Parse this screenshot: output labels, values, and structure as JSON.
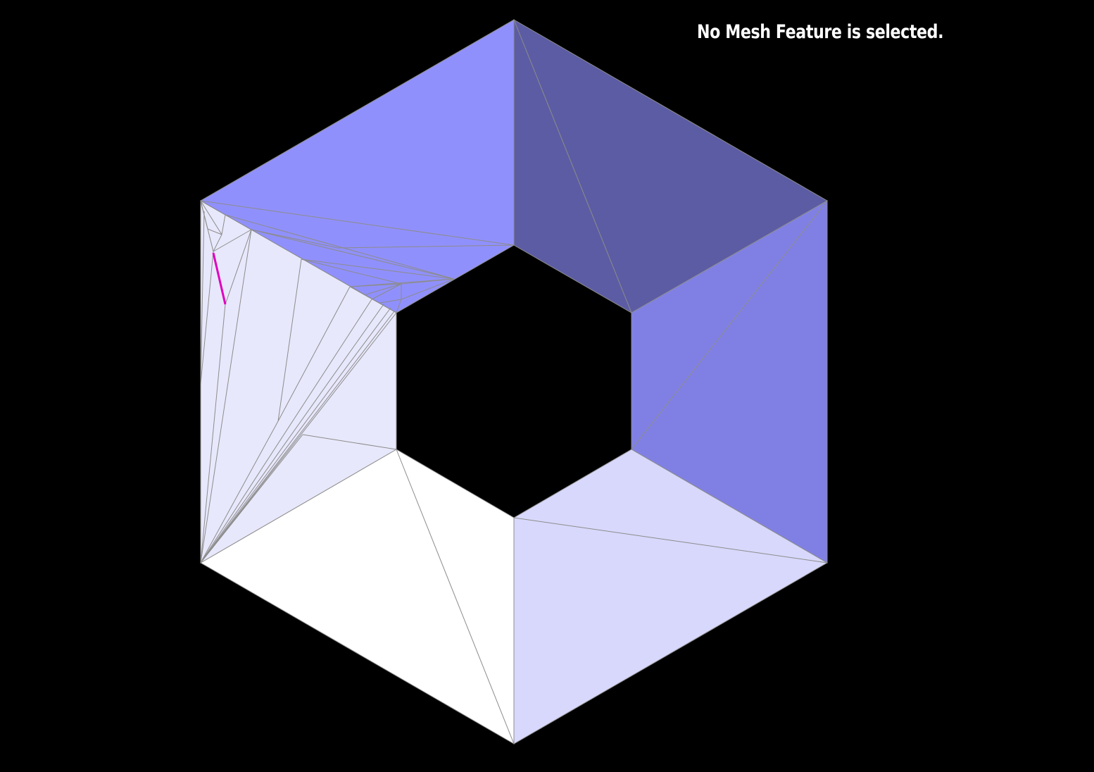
{
  "status_message": "No Mesh Feature is selected.",
  "colors": {
    "background": "#000000",
    "face_top_left": "#9090fc",
    "face_top_right": "#5c5ca4",
    "face_right": "#8080e4",
    "face_bottom_right": "#d8d8fc",
    "face_bottom_left": "#ffffff",
    "face_left": "#e8e8fc",
    "mesh_edge": "#8c8c8c",
    "highlight_edge": "#e000c0"
  }
}
